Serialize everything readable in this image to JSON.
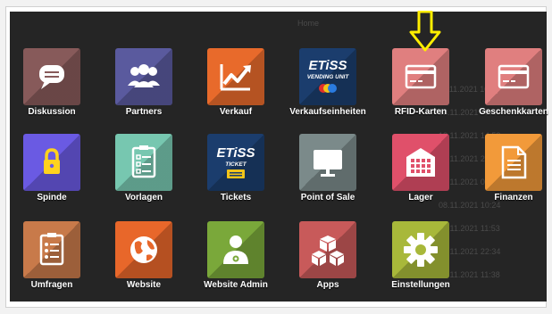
{
  "header": {
    "label": "Home"
  },
  "background_dates": [
    "11.11.2021 10:24",
    "23.11.2021 08:19",
    "12.11.2021 14:52",
    "16.11.2021 20:07",
    "04.11.2021 09:45",
    "08.11.2021 10:24",
    "16.11.2021 11:53",
    "29.11.2021 22:34",
    "01.11.2021 11:38"
  ],
  "apps": [
    {
      "label": "Diskussion",
      "color": "#875a5a",
      "icon": "chat-bubble-icon"
    },
    {
      "label": "Partners",
      "color": "#5a5a9e",
      "icon": "people-icon"
    },
    {
      "label": "Verkauf",
      "color": "#e86a2b",
      "icon": "trend-chart-icon"
    },
    {
      "label": "Verkaufseinheiten",
      "color": "#1b3d6d",
      "icon": "etiss-vending-logo",
      "logo_text": "ETiSS",
      "logo_sub": "VENDING UNIT"
    },
    {
      "label": "RFID-Karten",
      "color": "#e07f7f",
      "icon": "card-icon"
    },
    {
      "label": "Geschenkkarten",
      "color": "#e07f7f",
      "icon": "card-icon"
    },
    {
      "label": "Spinde",
      "color": "#6a5ae3",
      "icon": "padlock-icon"
    },
    {
      "label": "Vorlagen",
      "color": "#77c7b0",
      "icon": "clipboard-icon"
    },
    {
      "label": "Tickets",
      "color": "#1b3d6d",
      "icon": "etiss-ticket-logo",
      "logo_text": "ETiSS",
      "logo_sub": "TICKET"
    },
    {
      "label": "Point of Sale",
      "color": "#7b8a8a",
      "icon": "monitor-icon"
    },
    {
      "label": "Lager",
      "color": "#e0506a",
      "icon": "warehouse-icon"
    },
    {
      "label": "Finanzen",
      "color": "#f29a3a",
      "icon": "document-icon"
    },
    {
      "label": "Umfragen",
      "color": "#c87a4a",
      "icon": "survey-clipboard-icon"
    },
    {
      "label": "Website",
      "color": "#e8672a",
      "icon": "globe-icon"
    },
    {
      "label": "Website Admin",
      "color": "#7aa83a",
      "icon": "admin-user-icon"
    },
    {
      "label": "Apps",
      "color": "#c85a5a",
      "icon": "cubes-icon"
    },
    {
      "label": "Einstellungen",
      "color": "#a8b83a",
      "icon": "gear-icon"
    }
  ],
  "highlight_arrow": {
    "color": "#ffee00"
  }
}
